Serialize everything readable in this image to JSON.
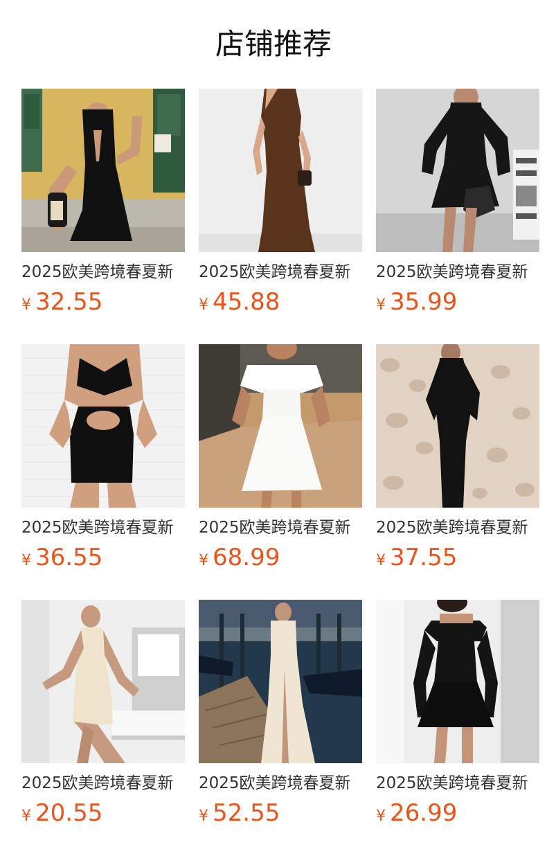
{
  "section": {
    "title": "店铺推荐"
  },
  "colors": {
    "price": "#e8541b",
    "title": "#111111",
    "name": "#333333"
  },
  "products": [
    {
      "name": "2025欧美跨境春夏新",
      "currency": "¥",
      "price": "32.55",
      "scene": "black-cutout-mermaid-dress"
    },
    {
      "name": "2025欧美跨境春夏新",
      "currency": "¥",
      "price": "45.88",
      "scene": "brown-one-shoulder-maxi-dress"
    },
    {
      "name": "2025欧美跨境春夏新",
      "currency": "¥",
      "price": "35.99",
      "scene": "black-bell-sleeve-mini-dress"
    },
    {
      "name": "2025欧美跨境春夏新",
      "currency": "¥",
      "price": "36.55",
      "scene": "black-cutout-halter-mini-dress"
    },
    {
      "name": "2025欧美跨境春夏新",
      "currency": "¥",
      "price": "68.99",
      "scene": "white-off-shoulder-dress"
    },
    {
      "name": "2025欧美跨境春夏新",
      "currency": "¥",
      "price": "37.55",
      "scene": "black-long-sleeve-maxi-dress"
    },
    {
      "name": "2025欧美跨境春夏新",
      "currency": "¥",
      "price": "20.55",
      "scene": "cream-halter-mini-dress"
    },
    {
      "name": "2025欧美跨境春夏新",
      "currency": "¥",
      "price": "52.55",
      "scene": "cream-strapless-slit-gown"
    },
    {
      "name": "2025欧美跨境春夏新",
      "currency": "¥",
      "price": "26.99",
      "scene": "black-off-shoulder-mini-dress"
    }
  ]
}
